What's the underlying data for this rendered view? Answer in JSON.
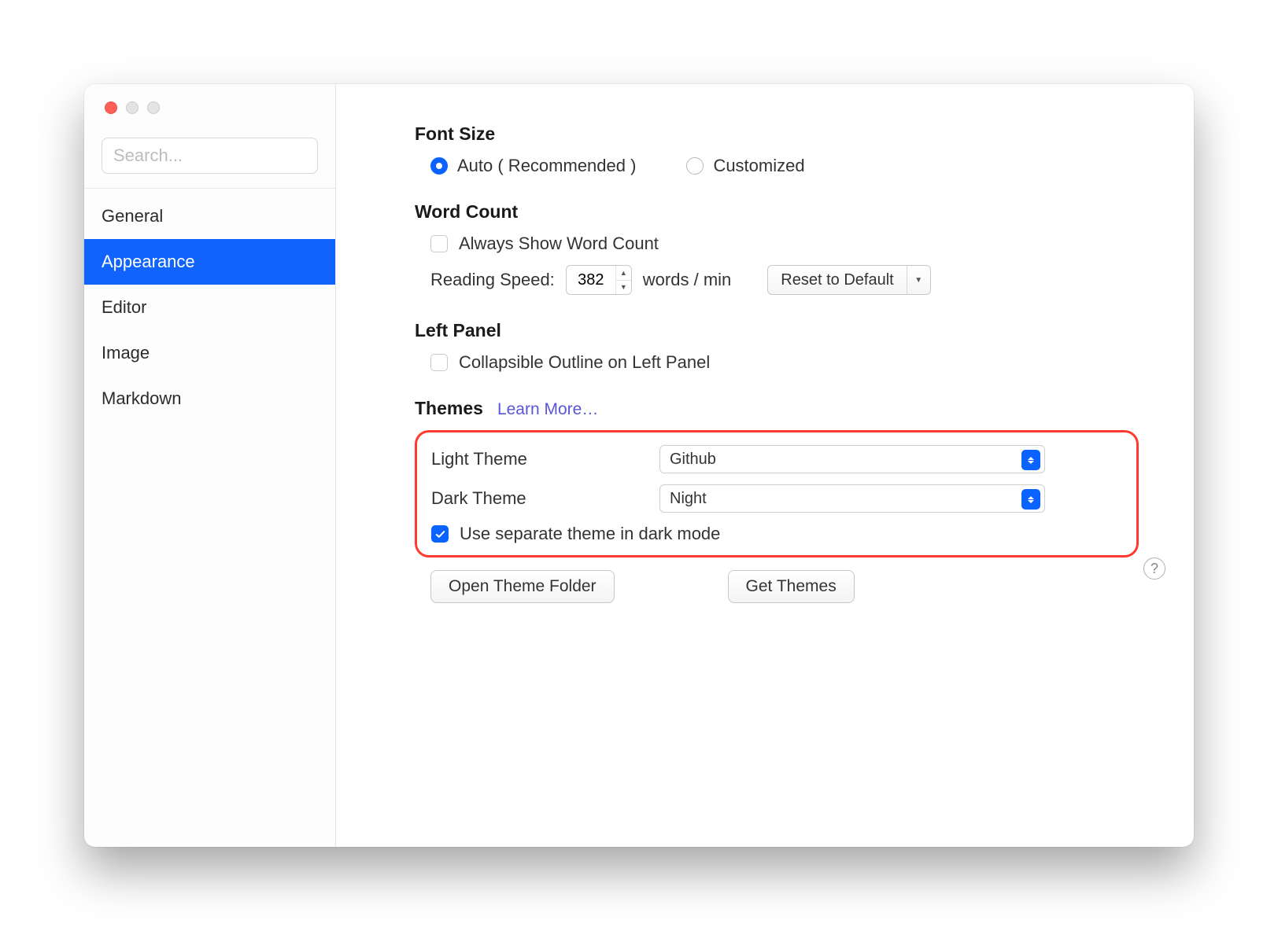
{
  "sidebar": {
    "search_placeholder": "Search...",
    "items": [
      {
        "label": "General",
        "active": false
      },
      {
        "label": "Appearance",
        "active": true
      },
      {
        "label": "Editor",
        "active": false
      },
      {
        "label": "Image",
        "active": false
      },
      {
        "label": "Markdown",
        "active": false
      }
    ]
  },
  "font_size": {
    "title": "Font Size",
    "auto_label": "Auto ( Recommended )",
    "customized_label": "Customized",
    "selected": "auto"
  },
  "word_count": {
    "title": "Word Count",
    "always_show_label": "Always Show Word Count",
    "always_show_checked": false,
    "reading_speed_label": "Reading Speed:",
    "reading_speed_value": "382",
    "units_label": "words / min",
    "reset_label": "Reset to Default"
  },
  "left_panel": {
    "title": "Left Panel",
    "collapsible_label": "Collapsible Outline on Left Panel",
    "collapsible_checked": false
  },
  "themes": {
    "title": "Themes",
    "learn_more": "Learn More…",
    "light_label": "Light Theme",
    "light_value": "Github",
    "dark_label": "Dark Theme",
    "dark_value": "Night",
    "separate_label": "Use separate theme in dark mode",
    "separate_checked": true,
    "open_folder_btn": "Open Theme Folder",
    "get_themes_btn": "Get Themes"
  }
}
